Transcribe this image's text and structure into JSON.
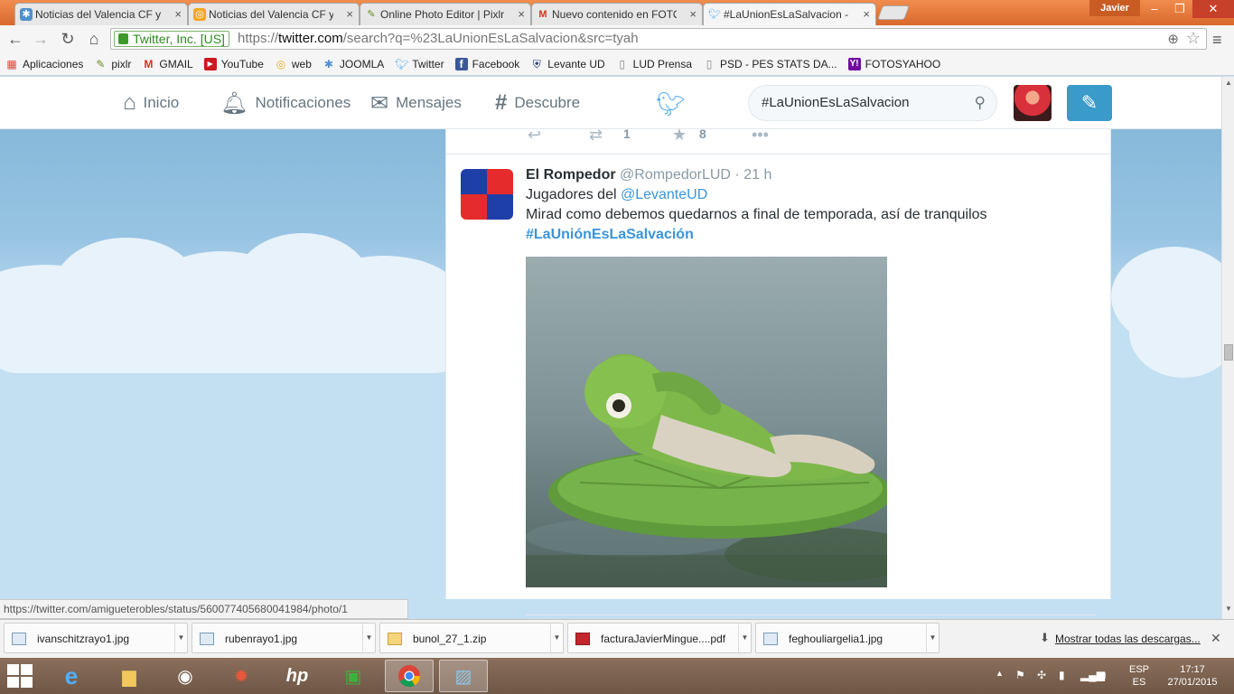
{
  "browser": {
    "tabs": [
      {
        "title": "Noticias del Valencia CF y",
        "favicon": "joomla"
      },
      {
        "title": "Noticias del Valencia CF y",
        "favicon": "web"
      },
      {
        "title": "Online Photo Editor | Pixlr",
        "favicon": "pixlr"
      },
      {
        "title": "Nuevo contenido en FOTO",
        "favicon": "gmail"
      },
      {
        "title": "#LaUnionEsLaSalvacion - T",
        "favicon": "twitter"
      }
    ],
    "user_name": "Javier",
    "ev_certificate": "Twitter, Inc. [US]",
    "url_scheme": "https://",
    "url_host": "twitter.com",
    "url_path": "/search?q=%23LaUnionEsLaSalvacion&src=tyah",
    "bookmarks": [
      {
        "label": "Aplicaciones",
        "icon": "apps-grid-icon",
        "color": "#e34234"
      },
      {
        "label": "pixlr",
        "icon": "pencil-icon",
        "color": "#6b8e23"
      },
      {
        "label": "GMAIL",
        "icon": "gmail-icon",
        "color": "#d93025"
      },
      {
        "label": "YouTube",
        "icon": "youtube-icon",
        "color": "#cc181e"
      },
      {
        "label": "web",
        "icon": "web-icon",
        "color": "#f5a623"
      },
      {
        "label": "JOOMLA",
        "icon": "joomla-icon",
        "color": "#5091cd"
      },
      {
        "label": "Twitter",
        "icon": "twitter-bird-icon",
        "color": "#55acee"
      },
      {
        "label": "Facebook",
        "icon": "facebook-icon",
        "color": "#3b5998"
      },
      {
        "label": "Levante UD",
        "icon": "shield-icon",
        "color": "#1b2a6b"
      },
      {
        "label": "LUD Prensa",
        "icon": "page-icon",
        "color": "#888888"
      },
      {
        "label": "PSD - PES STATS DA...",
        "icon": "page-icon",
        "color": "#888888"
      },
      {
        "label": "FOTOSYAHOO",
        "icon": "yahoo-icon",
        "color": "#720e9e"
      }
    ],
    "status_url": "https://twitter.com/amigueterobles/status/560077405680041984/photo/1"
  },
  "twitter": {
    "nav": {
      "home": "Inicio",
      "notifications": "Notificaciones",
      "messages": "Mensajes",
      "discover": "Descubre"
    },
    "search_value": "#LaUnionEsLaSalvacion",
    "brand_color": "#55acee",
    "prev_tweet": {
      "retweets": "1",
      "favorites": "8"
    },
    "tweet": {
      "fullname": "El Rompedor",
      "username": "@RompedorLUD",
      "separator": "·",
      "time": "21 h",
      "line1_prefix": "Jugadores del ",
      "line1_mention": "@LevanteUD",
      "line2": "Mirad como debemos quedarnos a final de temporada, así de tranquilos",
      "hashtag": "#LaUniónEsLaSalvación"
    }
  },
  "downloads": {
    "items": [
      {
        "name": "ivanschitzrayo1.jpg",
        "type": "image"
      },
      {
        "name": "rubenrayo1.jpg",
        "type": "image"
      },
      {
        "name": "bunol_27_1.zip",
        "type": "zip"
      },
      {
        "name": "facturaJavierMingue....pdf",
        "type": "pdf"
      },
      {
        "name": "feghouliargelia1.jpg",
        "type": "image"
      }
    ],
    "show_all": "Mostrar todas las descargas..."
  },
  "taskbar": {
    "language_top": "ESP",
    "language_bottom": "ES",
    "time": "17:17",
    "date": "27/01/2015"
  }
}
